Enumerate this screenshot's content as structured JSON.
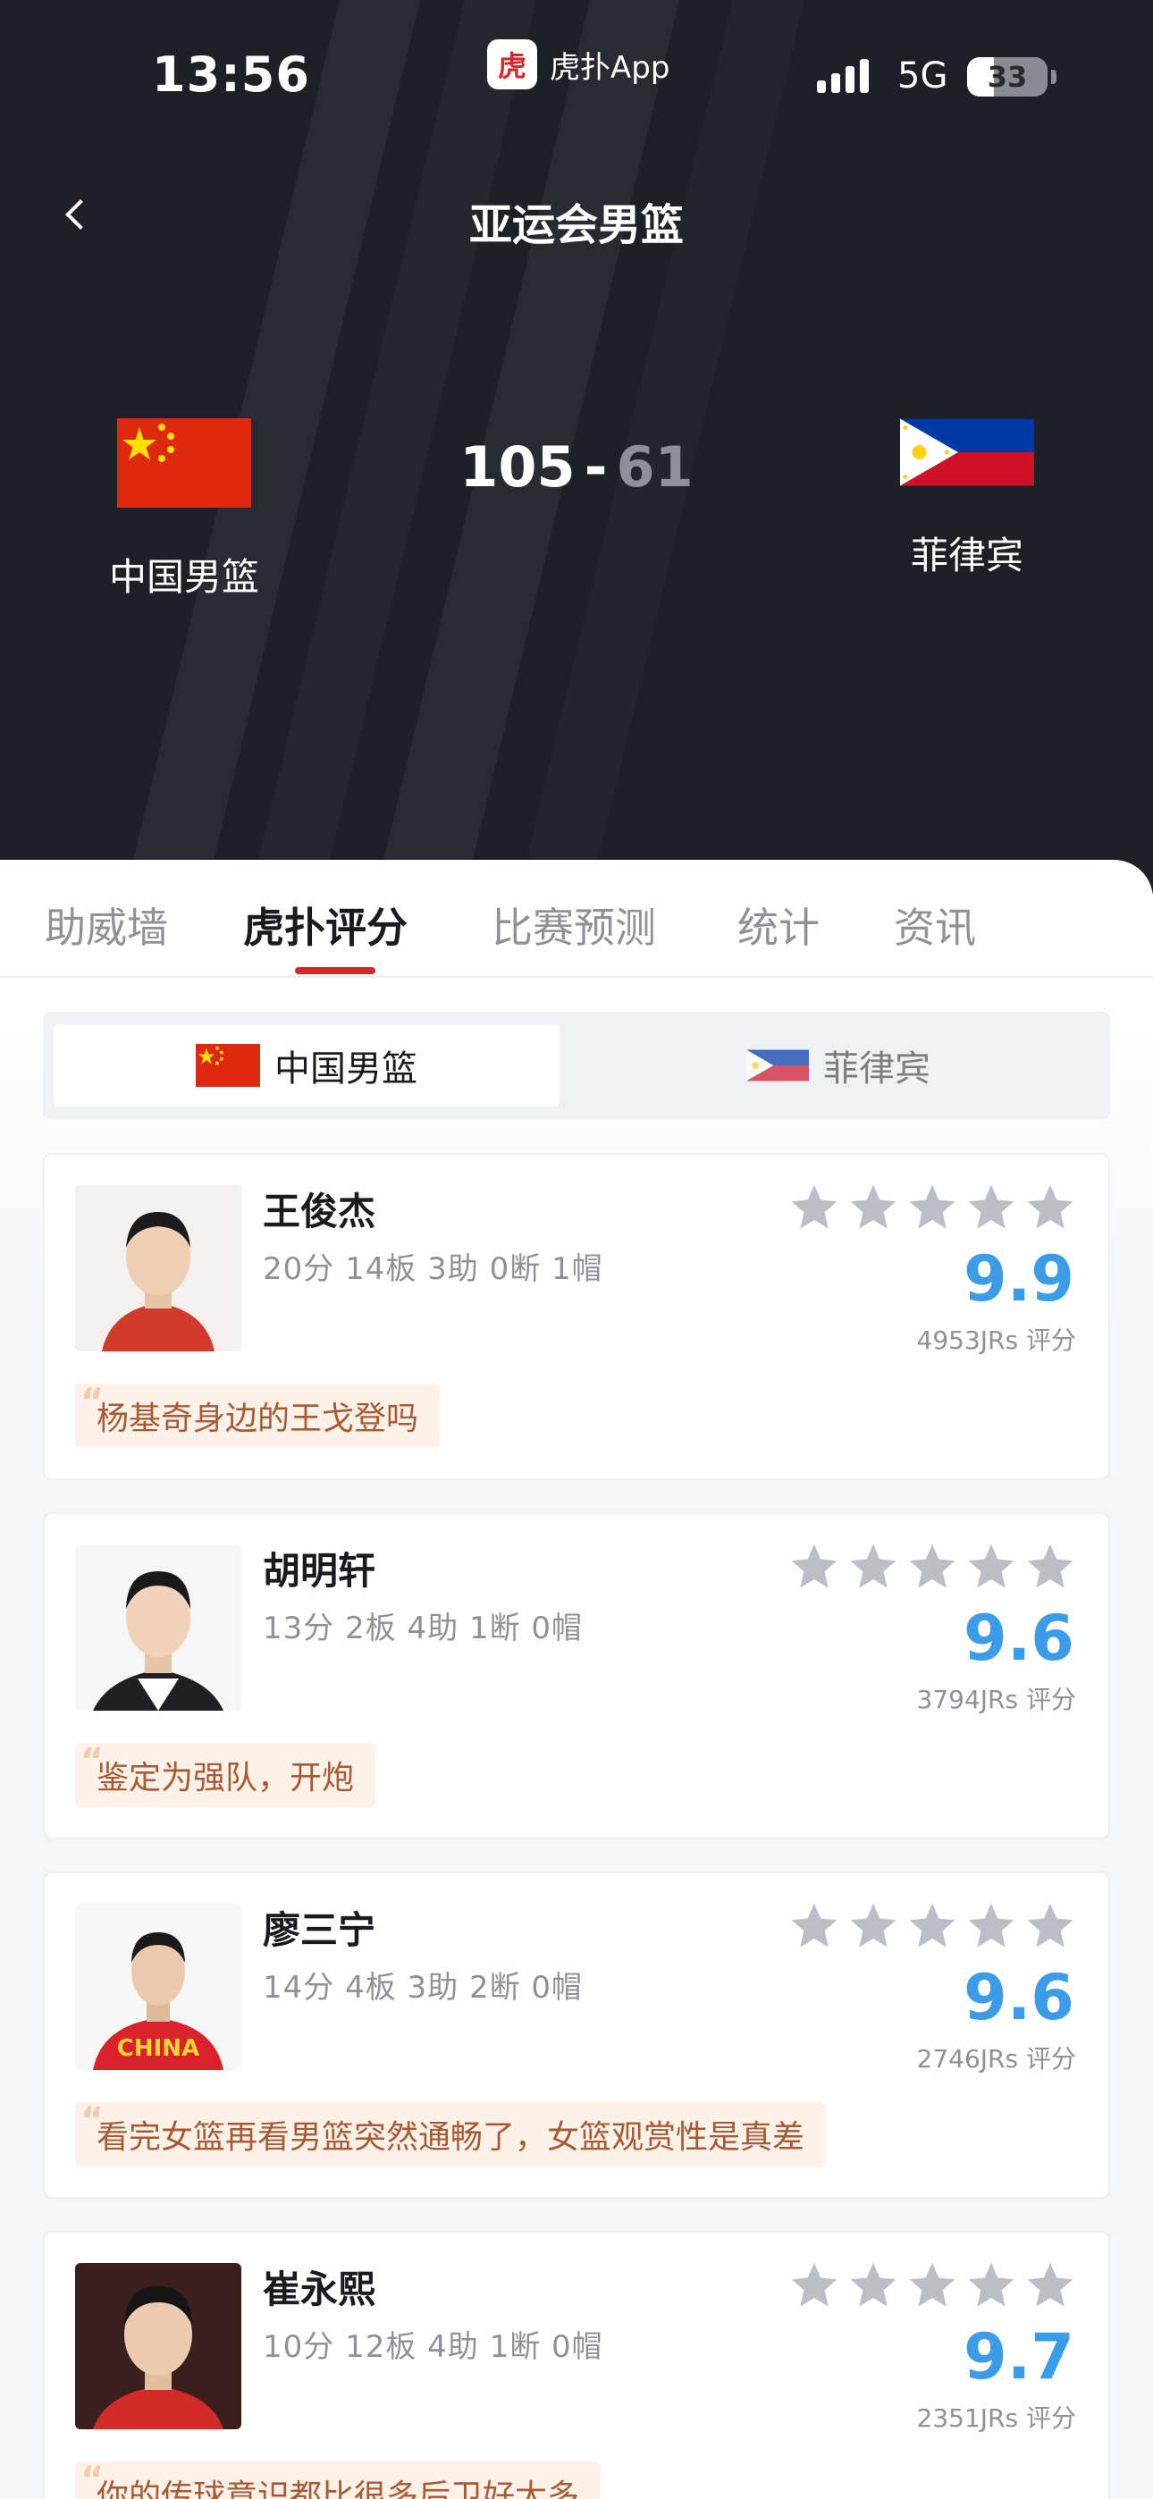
{
  "status_bar": {
    "time": "13:56",
    "app_name": "虎扑App",
    "app_icon_glyph": "虎",
    "network": "5G",
    "battery": "33",
    "battery_level": 0.33
  },
  "header": {
    "title": "亚运会男篮",
    "home": {
      "name": "中国男篮",
      "score": "105",
      "flag_icon": "china-flag-icon"
    },
    "away": {
      "name": "菲律宾",
      "score": "61",
      "flag_icon": "philippines-flag-icon"
    },
    "score_separator": "-"
  },
  "tabs": [
    {
      "label": "助威墙",
      "active": false
    },
    {
      "label": "虎扑评分",
      "active": true
    },
    {
      "label": "比赛预测",
      "active": false
    },
    {
      "label": "统计",
      "active": false
    },
    {
      "label": "资讯",
      "active": false
    }
  ],
  "team_toggle": {
    "selected": "中国男篮",
    "other": "菲律宾"
  },
  "players": [
    {
      "name": "王俊杰",
      "stats": "20分 14板 3助 0断 1帽",
      "rating": "9.9",
      "rating_count": "4953JRs 评分",
      "comment": "杨基奇身边的王戈登吗"
    },
    {
      "name": "胡明轩",
      "stats": "13分 2板 4助 1断 0帽",
      "rating": "9.6",
      "rating_count": "3794JRs 评分",
      "comment": "鉴定为强队，开炮"
    },
    {
      "name": "廖三宁",
      "stats": "14分 4板 3助 2断 0帽",
      "rating": "9.6",
      "rating_count": "2746JRs 评分",
      "comment": "看完女篮再看男篮突然通畅了，女篮观赏性是真差"
    },
    {
      "name": "崔永熙",
      "stats": "10分 12板 4助 1断 0帽",
      "rating": "9.7",
      "rating_count": "2351JRs 评分",
      "comment": "你的传球意识都比很多后卫好太多"
    }
  ],
  "colors": {
    "header_bg": "#1f2026",
    "accent_red": "#d7262c",
    "rating_blue": "#3c9ce8",
    "comment_bg": "#fdf1e8",
    "comment_text": "#a65b35",
    "star_gray": "#bcbec6"
  }
}
